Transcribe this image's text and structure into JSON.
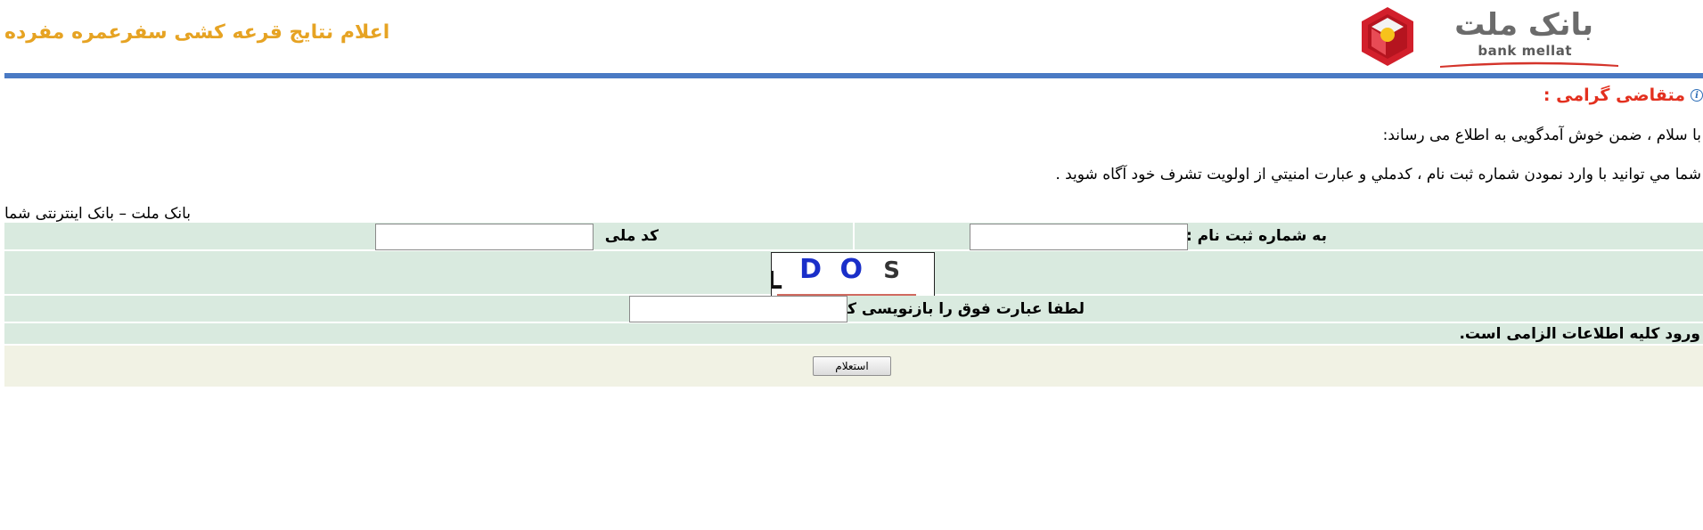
{
  "header": {
    "logo": {
      "name_fa": "بانک ملت",
      "name_en": "bank mellat"
    },
    "title": "اعلام نتایج قرعه کشی سفرعمره مفرده"
  },
  "intro": {
    "greeting": "متقاضی گرامی :",
    "line1": "با سلام ، ضمن خوش آمدگویی به اطلاع می رساند:",
    "line2": "شما مي توانيد با وارد نمودن شماره ثبت نام ، کدملي و عبارت امنيتي از اولويت تشرف خود آگاه شويد ."
  },
  "caption": "بانک ملت – بانک اینترنتی شما",
  "form": {
    "registration_label": "به شماره ثبت نام :",
    "registration_value": "",
    "national_code_label": "کد ملی",
    "national_code_value": "",
    "captcha": {
      "letters": [
        "L",
        "D",
        "O",
        "S"
      ],
      "colors": [
        "#111111",
        "#1a2fc9",
        "#1a2fc9",
        "#333333"
      ]
    },
    "captcha_label": "لطفا عبارت فوق را بازنویسی کنید",
    "captcha_value": "",
    "required_note": "ورود کلیه اطلاعات الزامی است.",
    "submit_label": "استعلام"
  },
  "colors": {
    "title": "#e6a323",
    "greeting": "#e3301f",
    "divider": "#4a7ac4",
    "row_bg": "#d9eadf",
    "footer_bg": "#f1f2e4"
  }
}
